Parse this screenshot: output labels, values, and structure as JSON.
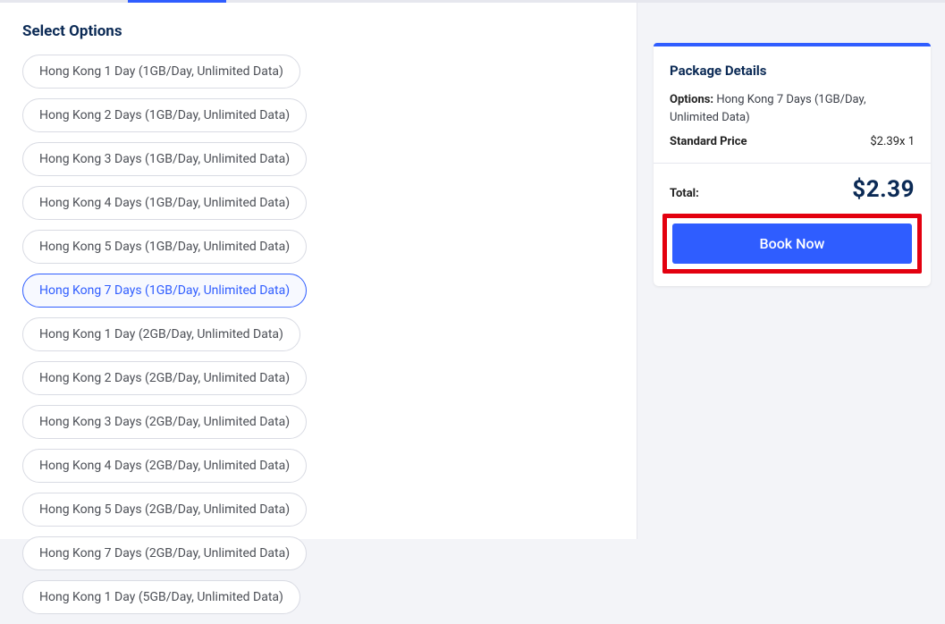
{
  "section_title": "Select Options",
  "options": [
    {
      "label": "Hong Kong 1 Day (1GB/Day, Unlimited Data)",
      "selected": false
    },
    {
      "label": "Hong Kong 2 Days (1GB/Day, Unlimited Data)",
      "selected": false
    },
    {
      "label": "Hong Kong 3 Days (1GB/Day, Unlimited Data)",
      "selected": false
    },
    {
      "label": "Hong Kong 4 Days (1GB/Day, Unlimited Data)",
      "selected": false
    },
    {
      "label": "Hong Kong 5 Days (1GB/Day, Unlimited Data)",
      "selected": false
    },
    {
      "label": "Hong Kong 7 Days (1GB/Day, Unlimited Data)",
      "selected": true
    },
    {
      "label": "Hong Kong 1 Day (2GB/Day, Unlimited Data)",
      "selected": false
    },
    {
      "label": "Hong Kong 2 Days (2GB/Day, Unlimited Data)",
      "selected": false
    },
    {
      "label": "Hong Kong 3 Days (2GB/Day, Unlimited Data)",
      "selected": false
    },
    {
      "label": "Hong Kong 4 Days (2GB/Day, Unlimited Data)",
      "selected": false
    },
    {
      "label": "Hong Kong 5 Days (2GB/Day, Unlimited Data)",
      "selected": false
    },
    {
      "label": "Hong Kong 7 Days (2GB/Day, Unlimited Data)",
      "selected": false
    },
    {
      "label": "Hong Kong 1 Day (5GB/Day, Unlimited Data)",
      "selected": false
    }
  ],
  "summary": {
    "title": "Package Details",
    "options_label": "Options:",
    "options_value": "Hong Kong 7 Days (1GB/Day, Unlimited Data)",
    "std_price_label": "Standard Price",
    "std_price_value": "$2.39",
    "qty_suffix": "x 1",
    "total_label": "Total:",
    "total_value": "$2.39",
    "book_label": "Book Now"
  }
}
